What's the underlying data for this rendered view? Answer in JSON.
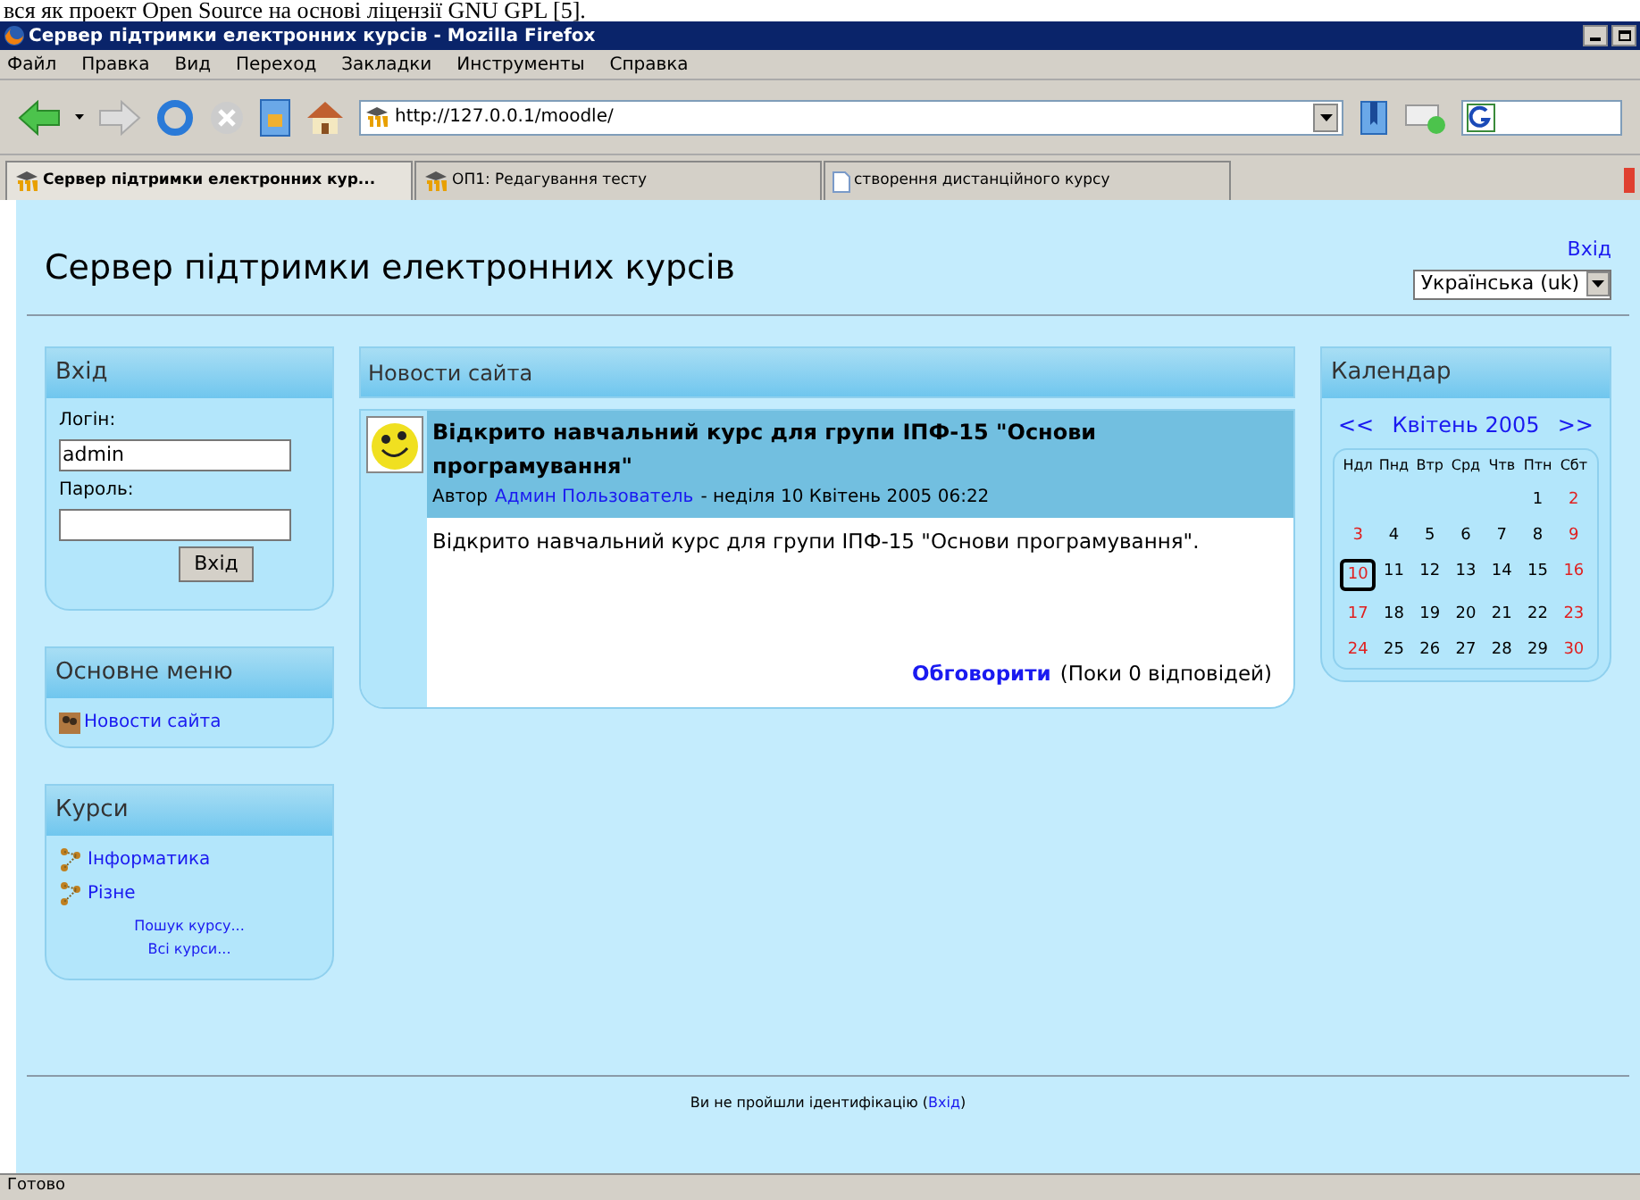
{
  "document_line": "вся як проект Open Source на основі ліцензії GNU GPL [5].",
  "window": {
    "title": "Сервер підтримки електронних курсів - Mozilla Firefox"
  },
  "menu": [
    "Файл",
    "Правка",
    "Вид",
    "Переход",
    "Закладки",
    "Инструменты",
    "Справка"
  ],
  "address": {
    "value": "http://127.0.0.1/moodle/"
  },
  "tabs": [
    {
      "label": "Сервер підтримки електронних кур...",
      "selected": true,
      "kind": "site"
    },
    {
      "label": "ОП1: Редагування тесту",
      "selected": false,
      "kind": "site"
    },
    {
      "label": "створення дистанційного курсу",
      "selected": false,
      "kind": "page"
    }
  ],
  "page": {
    "heading": "Сервер підтримки електронних курсів",
    "login_link": "Вхід",
    "language": "Українська (uk)"
  },
  "login_block": {
    "title": "Вхід",
    "login_label": "Логін:",
    "login_value": "admin",
    "password_label": "Пароль:",
    "button": "Вхід"
  },
  "main_menu": {
    "title": "Основне меню",
    "items": [
      "Новости сайта"
    ]
  },
  "courses": {
    "title": "Курси",
    "items": [
      "Інформатика",
      "Різне"
    ],
    "links": [
      "Пошук курсу...",
      "Всі курси..."
    ]
  },
  "news": {
    "title": "Новости сайта",
    "post_title": "Відкрито навчальний курс для групи ІПФ-15 \"Основи програмування\"",
    "author_prefix": "Автор",
    "author": "Админ Пользователь",
    "date": "- неділя 10 Квітень 2005 06:22",
    "body": "Відкрито навчальний курс для групи ІПФ-15 \"Основи програмування\".",
    "discuss": "Обговорити",
    "replies": "(Поки 0 відповідей)"
  },
  "calendar": {
    "title": "Календар",
    "prev": "<<",
    "month": "Квітень 2005",
    "next": ">>",
    "weekdays": [
      "Ндл",
      "Пнд",
      "Втр",
      "Срд",
      "Чтв",
      "Птн",
      "Сбт"
    ],
    "weeks": [
      [
        {
          "day": "1",
          "weekend": false,
          "today": false
        },
        {
          "day": "2",
          "weekend": true,
          "today": false
        }
      ],
      [
        {
          "day": "3",
          "weekend": true,
          "today": false
        },
        {
          "day": "4",
          "weekend": false,
          "today": false
        },
        {
          "day": "5",
          "weekend": false,
          "today": false
        },
        {
          "day": "6",
          "weekend": false,
          "today": false
        },
        {
          "day": "7",
          "weekend": false,
          "today": false
        },
        {
          "day": "8",
          "weekend": false,
          "today": false
        },
        {
          "day": "9",
          "weekend": true,
          "today": false
        }
      ],
      [
        {
          "day": "10",
          "weekend": true,
          "today": true
        },
        {
          "day": "11",
          "weekend": false,
          "today": false
        },
        {
          "day": "12",
          "weekend": false,
          "today": false
        },
        {
          "day": "13",
          "weekend": false,
          "today": false
        },
        {
          "day": "14",
          "weekend": false,
          "today": false
        },
        {
          "day": "15",
          "weekend": false,
          "today": false
        },
        {
          "day": "16",
          "weekend": true,
          "today": false
        }
      ],
      [
        {
          "day": "17",
          "weekend": true,
          "today": false
        },
        {
          "day": "18",
          "weekend": false,
          "today": false
        },
        {
          "day": "19",
          "weekend": false,
          "today": false
        },
        {
          "day": "20",
          "weekend": false,
          "today": false
        },
        {
          "day": "21",
          "weekend": false,
          "today": false
        },
        {
          "day": "22",
          "weekend": false,
          "today": false
        },
        {
          "day": "23",
          "weekend": true,
          "today": false
        }
      ],
      [
        {
          "day": "24",
          "weekend": true,
          "today": false
        },
        {
          "day": "25",
          "weekend": false,
          "today": false
        },
        {
          "day": "26",
          "weekend": false,
          "today": false
        },
        {
          "day": "27",
          "weekend": false,
          "today": false
        },
        {
          "day": "28",
          "weekend": false,
          "today": false
        },
        {
          "day": "29",
          "weekend": false,
          "today": false
        },
        {
          "day": "30",
          "weekend": true,
          "today": false
        }
      ]
    ]
  },
  "footer": {
    "text": "Ви не пройшли ідентифікацію (",
    "link": "Вхід",
    "text_end": ")"
  },
  "status_bar": "Готово"
}
